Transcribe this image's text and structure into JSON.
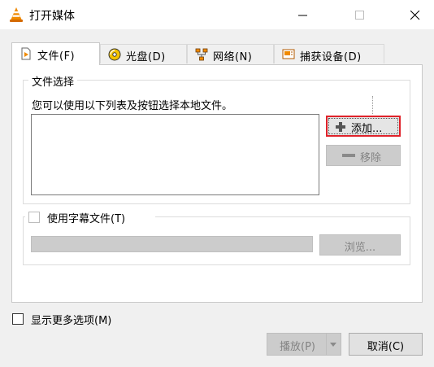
{
  "window": {
    "title": "打开媒体"
  },
  "tabs": [
    {
      "label": "文件(F)",
      "icon": "file-icon",
      "active": true
    },
    {
      "label": "光盘(D)",
      "icon": "disc-icon",
      "active": false
    },
    {
      "label": "网络(N)",
      "icon": "network-icon",
      "active": false
    },
    {
      "label": "捕获设备(D)",
      "icon": "capture-device-icon",
      "active": false
    }
  ],
  "file_selection": {
    "legend": "文件选择",
    "hint": "您可以使用以下列表及按钮选择本地文件。",
    "add_button": "添加...",
    "remove_button": "移除",
    "file_list": []
  },
  "subtitle": {
    "checkbox_label": "使用字幕文件(T)",
    "checked": false,
    "path_value": "",
    "browse_button": "浏览..."
  },
  "footer": {
    "show_more_label": "显示更多选项(M)",
    "show_more_checked": false,
    "play_button": "播放(P)",
    "cancel_button": "取消(C)"
  },
  "colors": {
    "accent_focus": "#e0222a",
    "vlc_orange": "#f08a00"
  }
}
